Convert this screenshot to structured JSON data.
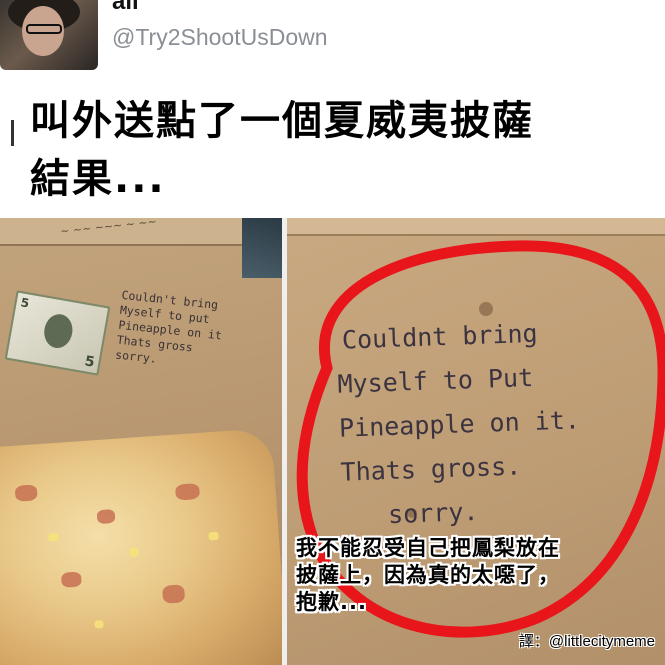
{
  "tweet": {
    "display_name": "ali",
    "handle": "@Try2ShootUsDown",
    "caption_lines": [
      "叫外送點了一個夏威夷披薩",
      "結果..."
    ]
  },
  "photo_left": {
    "note_lines": [
      "Couldn't bring",
      "Myself to put",
      "Pineapple on it",
      "Thats gross",
      "sorry."
    ],
    "bill_value": "5"
  },
  "photo_right": {
    "note_lines": [
      "Couldnt bring",
      "Myself to Put",
      "Pineapple on it.",
      "Thats gross.",
      "sorry."
    ],
    "highlight_color": "#e8161b"
  },
  "translation": {
    "lines": [
      "我不能忍受自己把鳳梨放在",
      "披薩上，因為真的太噁了，",
      "抱歉..."
    ],
    "credit": "譯：@littlecitymeme"
  }
}
